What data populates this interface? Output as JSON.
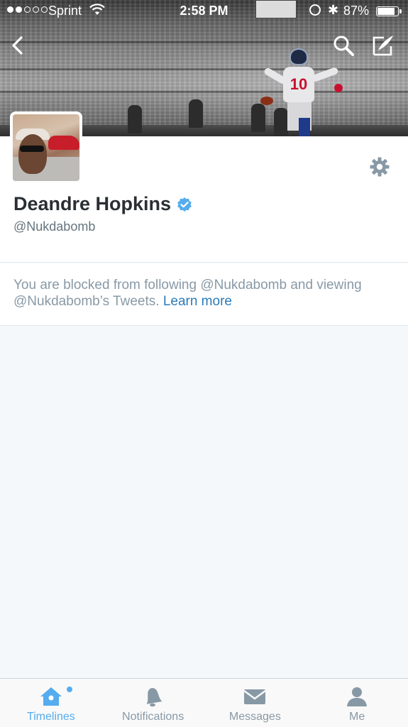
{
  "status_bar": {
    "carrier": "Sprint",
    "time": "2:58 PM",
    "battery_pct": "87%",
    "signal_bars_filled": 2,
    "signal_bars_total": 5
  },
  "header_nav": {
    "back_icon": "chevron-left-icon",
    "search_icon": "search-icon",
    "compose_icon": "compose-icon"
  },
  "banner": {
    "player_number": "10"
  },
  "profile": {
    "name": "Deandre Hopkins",
    "handle": "@Nukdabomb",
    "verified": true,
    "settings_icon": "gear-icon"
  },
  "notice": {
    "text": "You are blocked from following @Nukdabomb and viewing @Nukdabomb’s Tweets.",
    "link": "Learn more"
  },
  "tabs": [
    {
      "label": "Timelines",
      "icon": "home-icon",
      "active": true,
      "badge": true
    },
    {
      "label": "Notifications",
      "icon": "bell-icon",
      "active": false
    },
    {
      "label": "Messages",
      "icon": "envelope-icon",
      "active": false
    },
    {
      "label": "Me",
      "icon": "person-icon",
      "active": false
    }
  ],
  "colors": {
    "accent": "#55acee",
    "link": "#2b7bb9",
    "text_primary": "#292f33",
    "text_secondary": "#66757f",
    "text_muted": "#8899a6",
    "background": "#f5f8fa"
  }
}
